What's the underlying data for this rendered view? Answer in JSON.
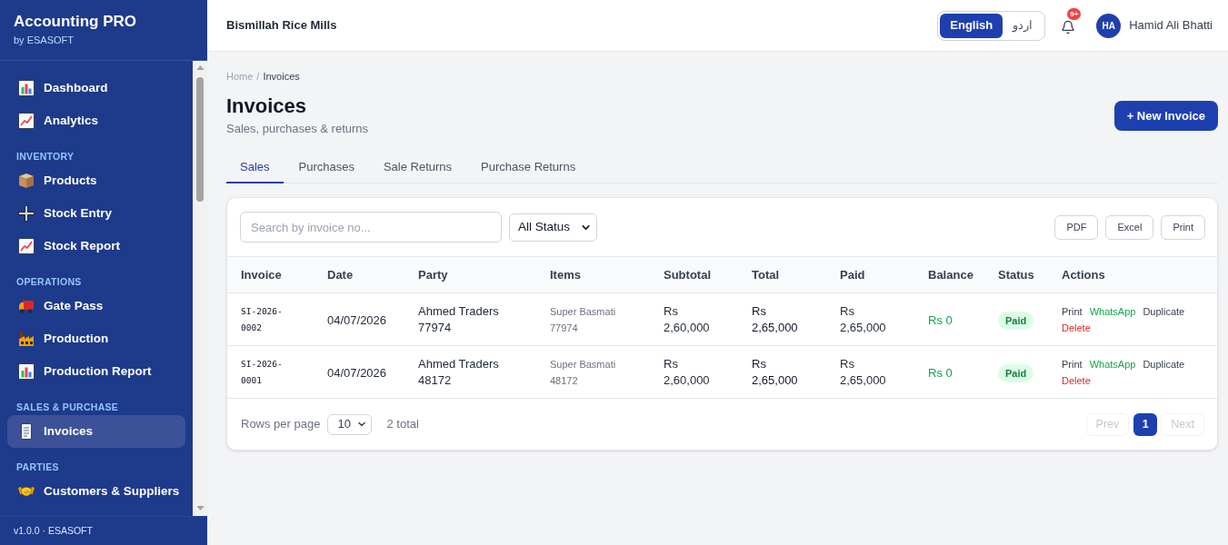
{
  "sidebar": {
    "brand": {
      "title": "Accounting PRO",
      "subtitle": "by ESASOFT"
    },
    "sections": [
      {
        "items": [
          {
            "label": "Dashboard",
            "selected": false
          },
          {
            "label": "Analytics",
            "selected": false
          }
        ]
      },
      {
        "heading": "INVENTORY",
        "items": [
          {
            "label": "Products",
            "selected": false
          },
          {
            "label": "Stock Entry",
            "selected": false
          },
          {
            "label": "Stock Report",
            "selected": false
          }
        ]
      },
      {
        "heading": "OPERATIONS",
        "items": [
          {
            "label": "Gate Pass",
            "selected": false
          },
          {
            "label": "Production",
            "selected": false
          },
          {
            "label": "Production Report",
            "selected": false
          }
        ]
      },
      {
        "heading": "SALES & PURCHASE",
        "items": [
          {
            "label": "Invoices",
            "selected": true
          }
        ]
      },
      {
        "heading": "PARTIES",
        "items": [
          {
            "label": "Customers & Suppliers",
            "selected": false
          }
        ]
      }
    ],
    "footer": "v1.0.0 · ESASOFT"
  },
  "topbar": {
    "company": "Bismillah Rice Mills",
    "languages": [
      {
        "label": "English",
        "selected": true
      },
      {
        "label": "اردو",
        "selected": false
      }
    ],
    "notification_badge": "9+",
    "user": {
      "initials": "HA",
      "name": "Hamid Ali Bhatti"
    }
  },
  "breadcrumb": {
    "items": [
      "Home",
      "Invoices"
    ],
    "separator": "/"
  },
  "page": {
    "title": "Invoices",
    "subtitle": "Sales, purchases & returns",
    "primary_action": "+ New Invoice"
  },
  "tabs": [
    {
      "label": "Sales",
      "selected": true
    },
    {
      "label": "Purchases",
      "selected": false
    },
    {
      "label": "Sale Returns",
      "selected": false
    },
    {
      "label": "Purchase Returns",
      "selected": false
    }
  ],
  "toolbar": {
    "search": {
      "placeholder": "Search by invoice no..."
    },
    "status_filter": {
      "value": "All Status"
    },
    "exports": [
      "PDF",
      "Excel",
      "Print"
    ]
  },
  "table": {
    "columns": [
      "Invoice",
      "Date",
      "Party",
      "Items",
      "Subtotal",
      "Total",
      "Paid",
      "Balance",
      "Status",
      "Actions"
    ],
    "rows": [
      {
        "invoice": "SI-2026-0002",
        "date": "04/07/2026",
        "party": "Ahmed Traders 77974",
        "items": "Super Basmati 77974",
        "subtotal": "Rs 2,60,000",
        "total": "Rs 2,65,000",
        "paid": "Rs 2,65,000",
        "balance": "Rs 0",
        "status": "Paid",
        "actions": [
          {
            "label": "Print",
            "kind": "neutral"
          },
          {
            "label": "WhatsApp",
            "kind": "positive"
          },
          {
            "label": "Duplicate",
            "kind": "neutral"
          },
          {
            "label": "Delete",
            "kind": "danger"
          }
        ]
      },
      {
        "invoice": "SI-2026-0001",
        "date": "04/07/2026",
        "party": "Ahmed Traders 48172",
        "items": "Super Basmati 48172",
        "subtotal": "Rs 2,60,000",
        "total": "Rs 2,65,000",
        "paid": "Rs 2,65,000",
        "balance": "Rs 0",
        "status": "Paid",
        "actions": [
          {
            "label": "Print",
            "kind": "neutral"
          },
          {
            "label": "WhatsApp",
            "kind": "positive"
          },
          {
            "label": "Duplicate",
            "kind": "neutral"
          },
          {
            "label": "Delete",
            "kind": "danger"
          }
        ]
      }
    ]
  },
  "pagination": {
    "rows_per_page_label": "Rows per page",
    "rows_per_page": "10",
    "total": "2 total",
    "prev": {
      "label": "Prev",
      "disabled": true
    },
    "pages": [
      {
        "label": "1",
        "selected": true
      }
    ],
    "next": {
      "label": "Next",
      "disabled": true
    }
  }
}
